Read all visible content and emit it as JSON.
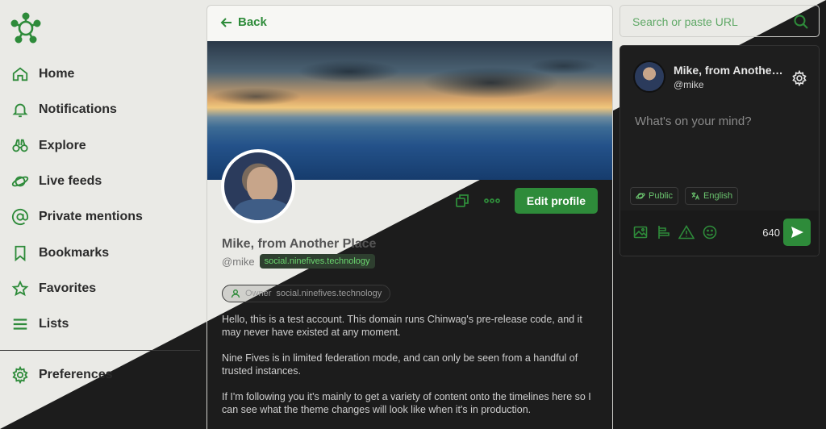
{
  "sidebar": {
    "items": [
      {
        "label": "Home",
        "icon": "home-icon"
      },
      {
        "label": "Notifications",
        "icon": "bell-icon"
      },
      {
        "label": "Explore",
        "icon": "binoculars-icon"
      },
      {
        "label": "Live feeds",
        "icon": "planet-icon"
      },
      {
        "label": "Private mentions",
        "icon": "at-icon"
      },
      {
        "label": "Bookmarks",
        "icon": "bookmark-icon"
      },
      {
        "label": "Favorites",
        "icon": "star-icon"
      },
      {
        "label": "Lists",
        "icon": "list-icon"
      }
    ],
    "preferences": {
      "label": "Preferences",
      "icon": "gear-icon"
    }
  },
  "profile": {
    "back_label": "Back",
    "display_name": "Mike, from Another Place",
    "handle": "@mike",
    "domain": "social.ninefives.technology",
    "edit_label": "Edit profile",
    "role_label": "Owner",
    "role_domain": "social.ninefives.technology",
    "bio": [
      "Hello, this is a test account. This domain runs Chinwag's pre-release code, and it may never have existed at any moment.",
      "Nine Fives is in limited federation mode, and can only be seen from a handful of trusted instances.",
      "If I'm following you it's mainly to get a variety of content onto the timelines here so I can see what the theme changes will look like when it's in production."
    ]
  },
  "search": {
    "placeholder": "Search or paste URL"
  },
  "composer": {
    "name": "Mike, from Another Place",
    "handle": "@mike",
    "placeholder": "What's on your mind?",
    "visibility": "Public",
    "language": "English",
    "char_count": "640"
  },
  "colors": {
    "accent": "#2e8b3a",
    "light_bg": "#eaeae6",
    "dark_bg": "#1c1c1c"
  }
}
